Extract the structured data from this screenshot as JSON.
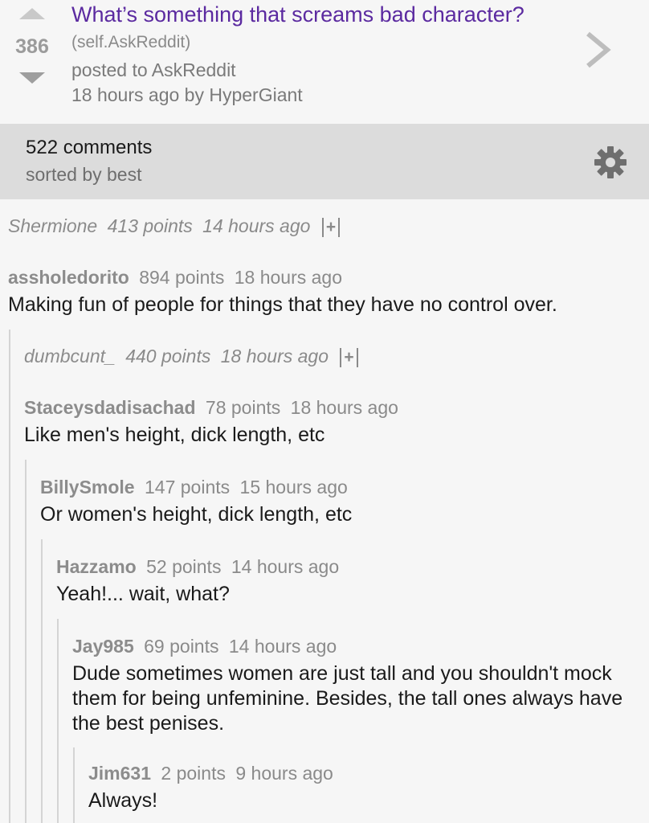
{
  "post": {
    "score": "386",
    "title": "What’s something that screams bad character?",
    "domain": "(self.AskReddit)",
    "posted_to": "posted to AskReddit",
    "posted_by": "18 hours ago by HyperGiant"
  },
  "comments_bar": {
    "count": "522 comments",
    "sort": "sorted by best"
  },
  "comments": [
    {
      "author": "Shermione",
      "points": "413 points",
      "time": "14 hours ago",
      "collapsed": true,
      "expand": "+",
      "body": ""
    },
    {
      "author": "assholedorito",
      "points": "894 points",
      "time": "18 hours ago",
      "collapsed": false,
      "body": "Making fun of people for things that they have no control over."
    },
    {
      "author": "dumbcunt_",
      "points": "440 points",
      "time": "18 hours ago",
      "collapsed": true,
      "expand": "+",
      "body": ""
    },
    {
      "author": "Staceysdadisachad",
      "points": "78 points",
      "time": "18 hours ago",
      "collapsed": false,
      "body": "Like men's height, dick length, etc"
    },
    {
      "author": "BillySmole",
      "points": "147 points",
      "time": "15 hours ago",
      "collapsed": false,
      "body": "Or women's height, dick length, etc"
    },
    {
      "author": "Hazzamo",
      "points": "52 points",
      "time": "14 hours ago",
      "collapsed": false,
      "body": "Yeah!... wait, what?"
    },
    {
      "author": "Jay985",
      "points": "69 points",
      "time": "14 hours ago",
      "collapsed": false,
      "body": "Dude sometimes women are just tall and you shouldn't mock them for being unfeminine. Besides, the tall ones always have the best penises."
    },
    {
      "author": "Jim631",
      "points": "2 points",
      "time": "9 hours ago",
      "collapsed": false,
      "body": "Always!"
    }
  ],
  "colors": {
    "title": "#5b2aa0",
    "bar_bg": "#dcdcdc",
    "page_bg": "#f6f6f6"
  },
  "icons": {
    "upvote": "up-arrow-icon",
    "downvote": "down-arrow-icon",
    "open": "chevron-right-icon",
    "settings": "gear-icon"
  }
}
